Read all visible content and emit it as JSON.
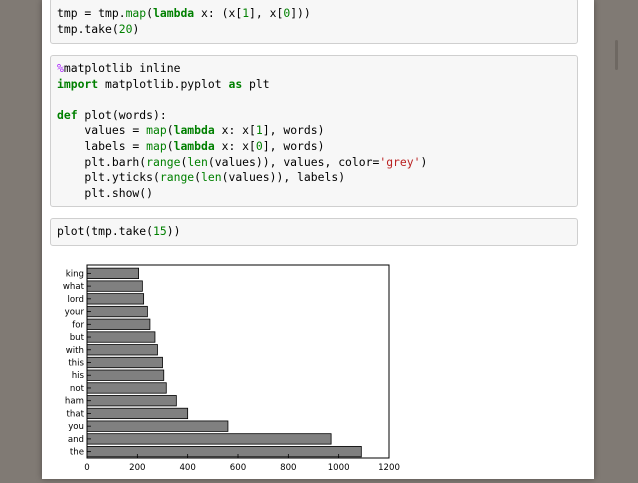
{
  "cell1": {
    "tokens": [
      [
        [
          "tmp = tmp.",
          "pn"
        ],
        [
          "map",
          "bi"
        ],
        [
          "(",
          "pn"
        ],
        [
          "lambda",
          "kw"
        ],
        [
          " x: (x[",
          "pn"
        ],
        [
          "1",
          "nm"
        ],
        [
          "], x[",
          "pn"
        ],
        [
          "0",
          "nm"
        ],
        [
          "]))",
          "pn"
        ]
      ],
      [
        [
          "tmp.take(",
          "pn"
        ],
        [
          "20",
          "nm"
        ],
        [
          ")",
          "pn"
        ]
      ]
    ]
  },
  "cell2": {
    "tokens": [
      [
        [
          "%",
          "mg"
        ],
        [
          "matplotlib inline",
          "pn"
        ]
      ],
      [
        [
          "import",
          "kw"
        ],
        [
          " matplotlib.pyplot ",
          "pn"
        ],
        [
          "as",
          "kw"
        ],
        [
          " plt",
          "pn"
        ]
      ],
      [
        [
          "",
          "pn"
        ]
      ],
      [
        [
          "def",
          "kw"
        ],
        [
          " plot(words):",
          "pn"
        ]
      ],
      [
        [
          "    values = ",
          "pn"
        ],
        [
          "map",
          "bi"
        ],
        [
          "(",
          "pn"
        ],
        [
          "lambda",
          "kw"
        ],
        [
          " x: x[",
          "pn"
        ],
        [
          "1",
          "nm"
        ],
        [
          "], words)",
          "pn"
        ]
      ],
      [
        [
          "    labels = ",
          "pn"
        ],
        [
          "map",
          "bi"
        ],
        [
          "(",
          "pn"
        ],
        [
          "lambda",
          "kw"
        ],
        [
          " x: x[",
          "pn"
        ],
        [
          "0",
          "nm"
        ],
        [
          "], words)",
          "pn"
        ]
      ],
      [
        [
          "    plt.barh(",
          "pn"
        ],
        [
          "range",
          "bi"
        ],
        [
          "(",
          "pn"
        ],
        [
          "len",
          "bi"
        ],
        [
          "(values)), values, color=",
          "pn"
        ],
        [
          "'grey'",
          "st"
        ],
        [
          ")",
          "pn"
        ]
      ],
      [
        [
          "    plt.yticks(",
          "pn"
        ],
        [
          "range",
          "bi"
        ],
        [
          "(",
          "pn"
        ],
        [
          "len",
          "bi"
        ],
        [
          "(values)), labels)",
          "pn"
        ]
      ],
      [
        [
          "    plt.show()",
          "pn"
        ]
      ]
    ]
  },
  "cell3": {
    "tokens": [
      [
        [
          "plot(tmp.take(",
          "pn"
        ],
        [
          "15",
          "nm"
        ],
        [
          "))",
          "pn"
        ]
      ]
    ]
  },
  "colors": {
    "bar": "#808080",
    "kw": "#008000",
    "st": "#ba2121",
    "mg": "#aa22ff"
  },
  "chart_data": {
    "type": "bar",
    "orientation": "horizontal",
    "categories": [
      "the",
      "and",
      "you",
      "that",
      "ham",
      "not",
      "his",
      "this",
      "with",
      "but",
      "for",
      "your",
      "lord",
      "what",
      "king"
    ],
    "values": [
      1090,
      970,
      560,
      400,
      355,
      315,
      305,
      300,
      280,
      270,
      250,
      240,
      225,
      220,
      205
    ],
    "xlim": [
      0,
      1200
    ],
    "xticks": [
      "0",
      "200",
      "400",
      "600",
      "800",
      "1000",
      "1200"
    ],
    "title": "",
    "xlabel": "",
    "ylabel": "",
    "grid": false
  }
}
